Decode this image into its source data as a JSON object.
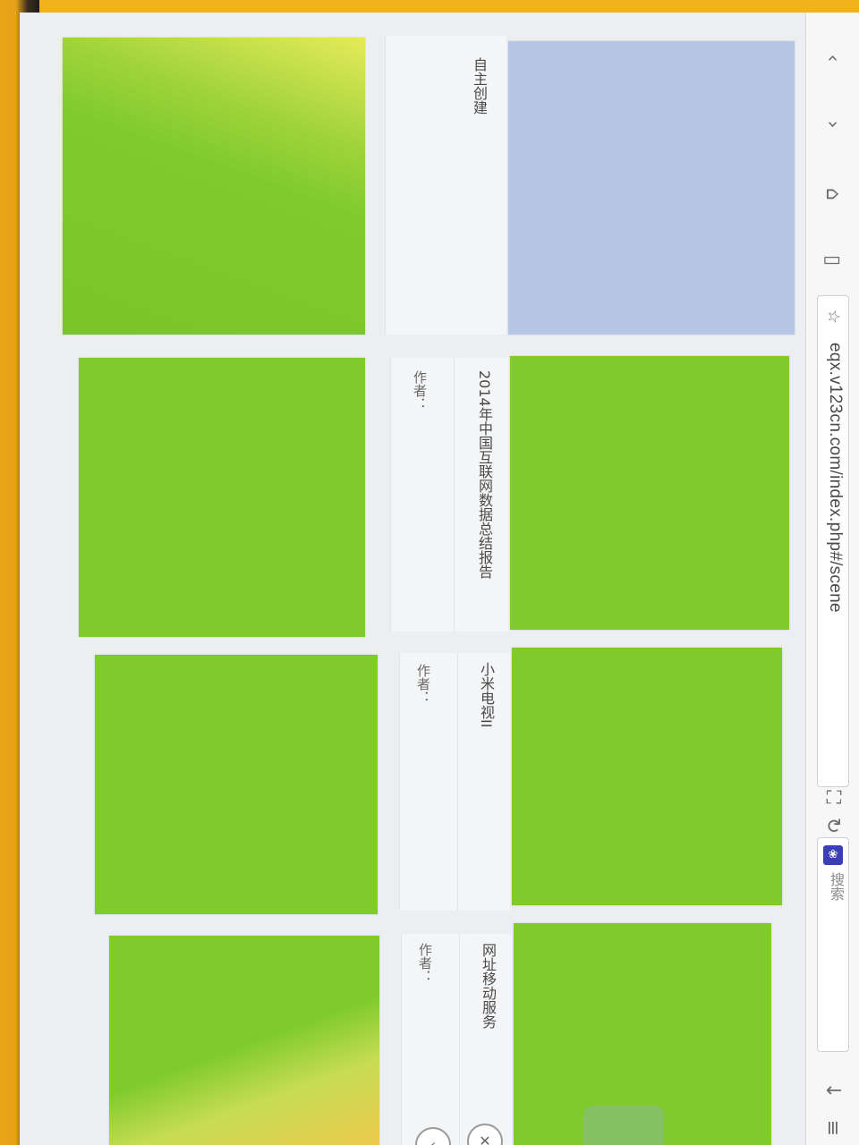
{
  "browser": {
    "url": "eqx.v123cn.com/index.php#/scene",
    "search_label": "搜索",
    "icons": [
      "back-icon",
      "home-icon",
      "bookmarks-icon",
      "star-icon",
      "link-icon",
      "fullscreen-icon",
      "refresh-icon",
      "baidu-icon",
      "download-icon",
      "menu-icon"
    ]
  },
  "scenes": {
    "create": {
      "label": "自主创建"
    },
    "items": [
      {
        "title": "2014年中国互联网数据总结报告",
        "author_label": "作者："
      },
      {
        "title": "小米电视II",
        "author_label": "作者："
      },
      {
        "title": "网址移动服务",
        "author_label": "作者："
      }
    ]
  },
  "colors": {
    "tile_green": "#7fcb2c",
    "tile_blue": "#b8c6e6",
    "panel": "#f4f5f7",
    "brand_badge": "#3a3fb8"
  }
}
